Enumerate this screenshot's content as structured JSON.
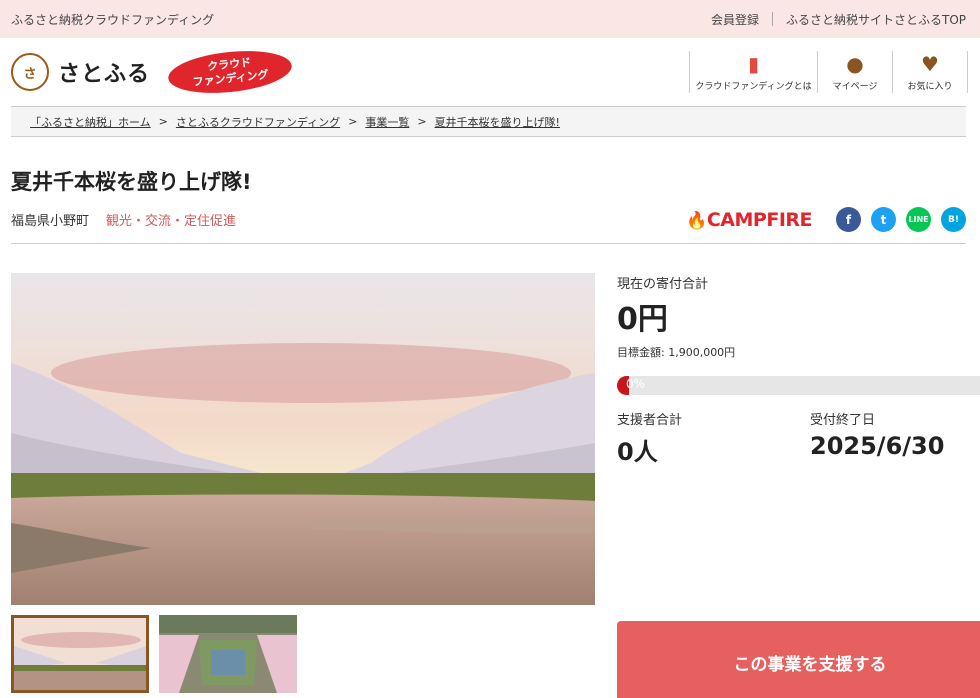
{
  "topbar": {
    "site_name": "ふるさと納税クラウドファンディング",
    "member_register": "会員登録",
    "site_top": "ふるさと納税サイトさとふるTOP"
  },
  "header": {
    "logo_mark": "さとふる",
    "logo_text": "さとふる",
    "badge_line1": "クラウド",
    "badge_line2": "ファンディング",
    "nav": [
      {
        "label": "クラウドファンディングとは",
        "icon": "book-icon"
      },
      {
        "label": "マイページ",
        "icon": "person-icon"
      },
      {
        "label": "お気に入り",
        "icon": "heart-icon"
      }
    ]
  },
  "breadcrumb": [
    "「ふるさと納税」ホーム",
    "さとふるクラウドファンディング",
    "事業一覧",
    "夏井千本桜を盛り上げ隊!"
  ],
  "project": {
    "title": "夏井千本桜を盛り上げ隊!",
    "location": "福島県小野町",
    "category": "観光・交流・定住促進",
    "partner": "CAMPFIRE"
  },
  "share": {
    "facebook": "f",
    "twitter": "t",
    "line": "LINE",
    "hatena": "B!"
  },
  "funding": {
    "current_label": "現在の寄付合計",
    "current_amount": "0円",
    "goal_text": "目標金額: 1,900,000円",
    "progress_text": "0%",
    "progress_value": 0,
    "supporters_label": "支援者合計",
    "supporters_value": "0人",
    "deadline_label": "受付終了日",
    "deadline_value": "2025/6/30",
    "cta_label": "この事業を支援する"
  },
  "colors": {
    "accent": "#e76060",
    "brand_red": "#e0262c",
    "brown": "#8a5520"
  }
}
